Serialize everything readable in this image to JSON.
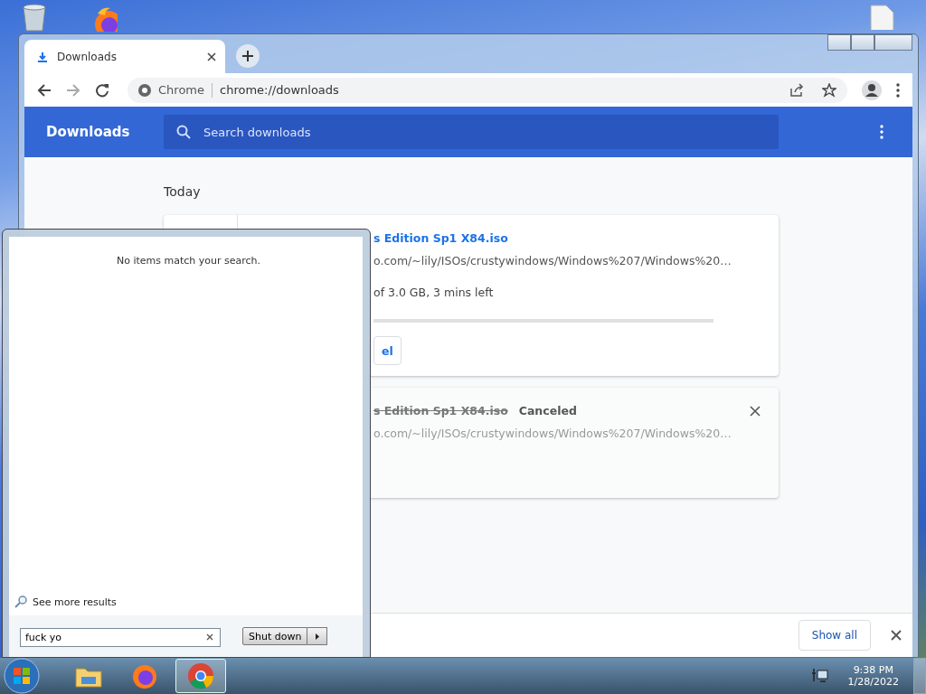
{
  "browser": {
    "tabs": [
      {
        "label": "Downloads",
        "selected": true
      }
    ],
    "omnibox": {
      "site": "Chrome",
      "url": "chrome://downloads"
    },
    "page": {
      "title": "Downloads",
      "search": {
        "placeholder": "Search downloads"
      },
      "date_heading": "Today",
      "downloads": [
        {
          "kind": "active",
          "file": "s Edition Sp1 X84.iso",
          "url": "o.com/~lily/ISOs/crustywindows/Windows%207/Windows%20…",
          "progress": "of 3.0 GB, 3 mins left",
          "level": 0,
          "action": "el"
        },
        {
          "kind": "canceled",
          "file": "s Edition Sp1 X84.iso",
          "status": "Canceled",
          "url": "o.com/~lily/ISOs/crustywindows/Windows%207/Windows%20…"
        }
      ]
    },
    "shelf": {
      "show_all": "Show all"
    }
  },
  "start_menu": {
    "message": "No items match your search.",
    "see_more": "See more results",
    "search_value": "fuck yo",
    "shutdown": "Shut down"
  },
  "taskbar": {
    "apps": [
      {
        "kind": "explorer",
        "selected": false
      },
      {
        "kind": "firefox",
        "selected": false
      },
      {
        "kind": "chrome",
        "selected": true
      }
    ],
    "time": "9:38 PM",
    "date": "1/28/2022"
  }
}
